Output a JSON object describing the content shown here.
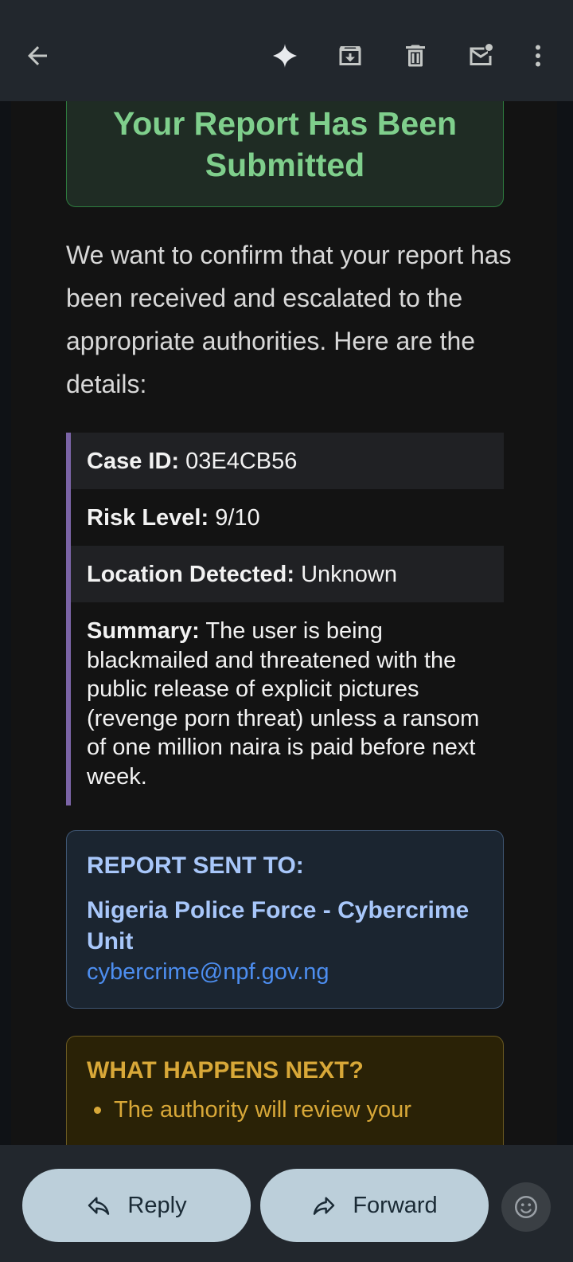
{
  "toolbar": {
    "back": "back-arrow-icon",
    "gemini": "sparkle-icon",
    "archive": "archive-icon",
    "delete": "trash-icon",
    "mark_unread": "mark-unread-icon",
    "more": "more-vert-icon"
  },
  "email": {
    "hero_title": "Your Report Has Been Submitted",
    "intro": "We want to confirm that your report has been received and escalated to the appropriate authorities. Here are the details:",
    "details": [
      {
        "label": "Case ID:",
        "value": "03E4CB56"
      },
      {
        "label": "Risk Level:",
        "value": "9/10"
      },
      {
        "label": "Location Detected:",
        "value": "Unknown"
      },
      {
        "label": "Summary:",
        "value": "The user is being blackmailed and threatened with the public release of explicit pictures (revenge porn threat) unless a ransom of one million naira is paid before next week."
      }
    ],
    "sent_to": {
      "title": "REPORT SENT TO:",
      "org": "Nigeria Police Force - Cybercrime Unit",
      "email": "cybercrime@npf.gov.ng"
    },
    "next": {
      "title": "WHAT HAPPENS NEXT?",
      "items": [
        "The authority will review your"
      ]
    }
  },
  "actions": {
    "reply": "Reply",
    "forward": "Forward",
    "emoji": "add-emoji-icon"
  },
  "colors": {
    "success": "#7fcf8c",
    "accent_blue": "#a8c7fa",
    "link": "#4d8ef0",
    "warning": "#d8a838",
    "quote_bar": "#7b64a6"
  }
}
